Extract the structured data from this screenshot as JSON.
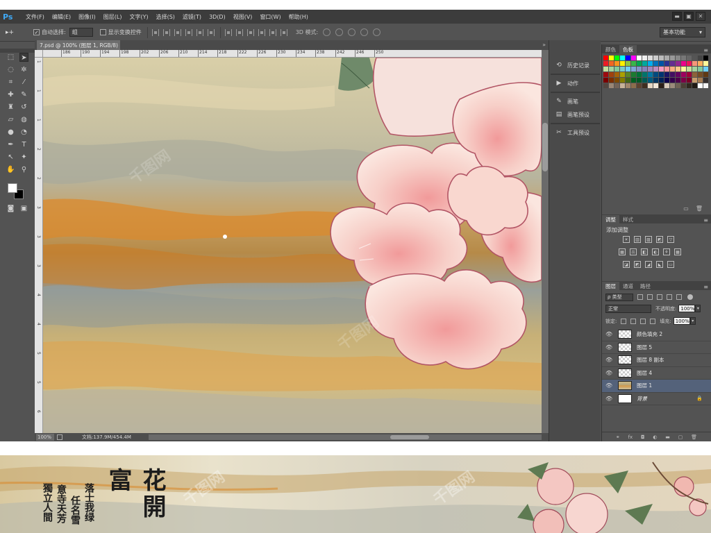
{
  "app": {
    "logo": "Ps",
    "menu": [
      "文件(F)",
      "编辑(E)",
      "图像(I)",
      "图层(L)",
      "文字(Y)",
      "选择(S)",
      "滤镜(T)",
      "3D(D)",
      "视图(V)",
      "窗口(W)",
      "帮助(H)"
    ],
    "window_controls": [
      "▬",
      "▣",
      "✕"
    ]
  },
  "options": {
    "tool_glyph": "▸+",
    "auto_select_label": "自动选择:",
    "auto_select_value": "组",
    "show_transform_label": "显示变换控件",
    "mode3d_label": "3D 模式:",
    "workspace": "基本功能"
  },
  "document": {
    "tab_title": "7.psd @ 100% (图层 1, RGB/8)",
    "tab_close": "×",
    "collapse": "»",
    "ruler_h": [
      "186",
      "190",
      "194",
      "198",
      "202",
      "206",
      "210",
      "214",
      "218",
      "222",
      "226",
      "230",
      "234",
      "238",
      "242",
      "246",
      "250"
    ],
    "ruler_v": [
      "1",
      "1",
      "1",
      "2",
      "2",
      "3",
      "3",
      "3",
      "4",
      "4",
      "5",
      "5",
      "6"
    ],
    "zoom": "100%",
    "doc_info": "文档:137.9M/454.4M",
    "status_arrow": "▶"
  },
  "dock": {
    "items": [
      {
        "icon": "⟲",
        "label": "历史记录"
      },
      {
        "icon": "▶",
        "label": "动作"
      },
      {
        "icon": "✎",
        "label": "画笔"
      },
      {
        "icon": "▤",
        "label": "画笔预设"
      },
      {
        "icon": "✂",
        "label": "工具预设"
      }
    ]
  },
  "swatches": {
    "tabs": [
      "颜色",
      "色板"
    ],
    "menu": "≡",
    "footer": [
      "▭",
      "🗑"
    ],
    "colors": [
      "#ff0000",
      "#ffff00",
      "#00ff00",
      "#00ffff",
      "#0000ff",
      "#ff00ff",
      "#ffffff",
      "#eeeeee",
      "#dddddd",
      "#cccccc",
      "#bbbbbb",
      "#aaaaaa",
      "#999999",
      "#888888",
      "#777777",
      "#666666",
      "#555555",
      "#444444",
      "#000000",
      "#ed1c24",
      "#f26522",
      "#f7941d",
      "#fff200",
      "#8dc63f",
      "#39b54a",
      "#00a651",
      "#00a99d",
      "#00aeef",
      "#0072bc",
      "#0054a6",
      "#2e3192",
      "#662d91",
      "#92278f",
      "#ec008c",
      "#ed145b",
      "#f69679",
      "#fbaf5d",
      "#fff799",
      "#c4df9b",
      "#a3d39c",
      "#82ca9c",
      "#7accc8",
      "#6dcff6",
      "#7ea7d8",
      "#8393ca",
      "#8781bd",
      "#a186be",
      "#bd8cbf",
      "#f49ac1",
      "#f5989d",
      "#f9ad81",
      "#fdc68a",
      "#fff79a",
      "#c4df9b",
      "#a3d39c",
      "#82ca9c",
      "#6dcff6",
      "#9e0b0f",
      "#a0410d",
      "#a36209",
      "#aba000",
      "#598527",
      "#1a7b30",
      "#007236",
      "#00746b",
      "#0076a3",
      "#004a80",
      "#003471",
      "#1b1464",
      "#440e62",
      "#630460",
      "#9e005d",
      "#9e0039",
      "#8c6239",
      "#754c24",
      "#603913",
      "#790000",
      "#7b2e00",
      "#7d4900",
      "#827b00",
      "#406618",
      "#005e20",
      "#005826",
      "#005952",
      "#005b7f",
      "#003663",
      "#002157",
      "#0d004c",
      "#32004b",
      "#4b0049",
      "#7b0046",
      "#7a0026",
      "#c69c6d",
      "#a67c52",
      "#362f2d",
      "#534741",
      "#998675",
      "#736357",
      "#c7b299",
      "#a0866b",
      "#8b6d4c",
      "#5c4330",
      "#3f2e20",
      "#e6d6c3",
      "#f1e6d7",
      "#2b1f17",
      "#d7c9b8",
      "#9b8b7b",
      "#6f6255",
      "#4a3f35",
      "#30281f",
      "#201a14",
      "#ffffff",
      "#f5f5f5"
    ]
  },
  "adjustments": {
    "tabs": [
      "调整",
      "样式"
    ],
    "title": "添加调整",
    "row1": [
      "☀",
      "▥",
      "▨",
      "◩",
      "▽"
    ],
    "row2": [
      "▦",
      "⚖",
      "◧",
      "◐",
      "⚘",
      "▦"
    ],
    "row3": [
      "◪",
      "◩",
      "◢",
      "◣",
      "▭"
    ]
  },
  "layers": {
    "tabs": [
      "图层",
      "通道",
      "路径"
    ],
    "filter_kind": "ρ 类型",
    "blend_mode": "正常",
    "opacity_label": "不透明度:",
    "opacity": "100%",
    "lock_label": "锁定:",
    "fill_label": "填充:",
    "fill": "100%",
    "list": [
      {
        "name": "颜色填充 2",
        "thumb": "checker",
        "selected": false,
        "locked": false
      },
      {
        "name": "图层 5",
        "thumb": "checker",
        "selected": false,
        "locked": false
      },
      {
        "name": "图层 8 副本",
        "thumb": "checker",
        "selected": false,
        "locked": false
      },
      {
        "name": "图层 4",
        "thumb": "checker",
        "selected": false,
        "locked": false
      },
      {
        "name": "图层 1",
        "thumb": "marble",
        "selected": true,
        "locked": false
      },
      {
        "name": "背景",
        "thumb": "white",
        "selected": false,
        "locked": true
      }
    ],
    "footer": [
      "⚭",
      "fx",
      "◘",
      "◐",
      "▬",
      "▢",
      "🗑"
    ]
  },
  "banner": {
    "title_glyphs": "花開富",
    "poem_col1": "落士我绿",
    "poem_col2": "任名雪",
    "poem_col3": "意寺天芳",
    "poem_col4": "獨立人間"
  }
}
